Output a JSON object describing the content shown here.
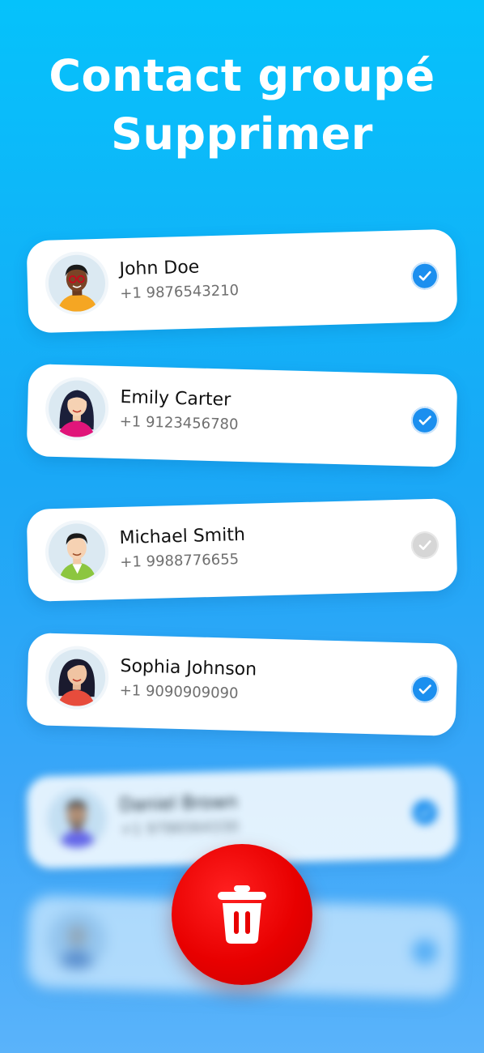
{
  "header": {
    "line1": "Contact groupé",
    "line2": "Supprimer"
  },
  "contacts": [
    {
      "name": "John Doe",
      "phone": "+1 9876543210",
      "selected": true,
      "avatar": "man-glasses-avatar"
    },
    {
      "name": "Emily Carter",
      "phone": "+1 9123456780",
      "selected": true,
      "avatar": "woman-avatar"
    },
    {
      "name": "Michael Smith",
      "phone": "+1 9988776655",
      "selected": false,
      "avatar": "man-avatar"
    },
    {
      "name": "Sophia Johnson",
      "phone": "+1 9090909090",
      "selected": true,
      "avatar": "woman-avatar"
    },
    {
      "name": "Daniel Brown",
      "phone": "+1 9786564330",
      "selected": true,
      "avatar": "man-beard-avatar"
    }
  ],
  "delete_button": {
    "icon": "trash-icon"
  },
  "colors": {
    "accent": "#1b8fef",
    "delete": "#e80000",
    "background_top": "#05c2fb",
    "background_bottom": "#5ab3fa"
  }
}
